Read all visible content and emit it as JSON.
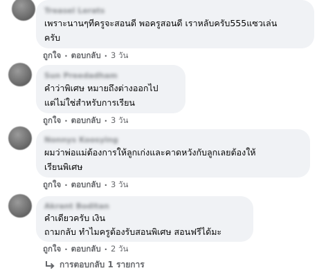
{
  "comments": [
    {
      "author": "Treasel Lerats",
      "lines": [
        "เพราะนานๆทีครูจะสอนดี พอครูสอนดี เราหลับครับ555แซวเล่น",
        "ครับ"
      ],
      "like_label": "ถูกใจ",
      "reply_label": "ตอบกลับ",
      "time": "3 วัน"
    },
    {
      "author": "Sun Preedadham",
      "lines": [
        "คำว่าพิเศษ หมายถึงต่างออกไป",
        "แต่ไม่ใช่สำหรับการเรียน"
      ],
      "like_label": "ถูกใจ",
      "reply_label": "ตอบกลับ",
      "time": "3 วัน"
    },
    {
      "author": "Nonnys Koosying",
      "lines": [
        "ผมว่าพ่อแม่ต้องการให้ลูกเก่งและคาดหวังกับลูกเลยต้องให้",
        "เรียนพิเศษ"
      ],
      "like_label": "ถูกใจ",
      "reply_label": "ตอบกลับ",
      "time": "3 วัน"
    },
    {
      "author": "Akrant Boditan",
      "lines": [
        "คำเดียวครับ เงิน",
        "ถามกลับ ทำไมครูต้องรับสอนพิเศษ สอนฟรีได้มะ"
      ],
      "like_label": "ถูกใจ",
      "reply_label": "ตอบกลับ",
      "time": "2 วัน"
    }
  ],
  "replies_link": "การตอบกลับ 1 รายการ",
  "icons": {
    "reply": "reply-arrow-icon",
    "avatar": "avatar"
  },
  "colors": {
    "bubble": "#f0f2f5",
    "secondary_text": "#65676b",
    "text": "#050505"
  }
}
